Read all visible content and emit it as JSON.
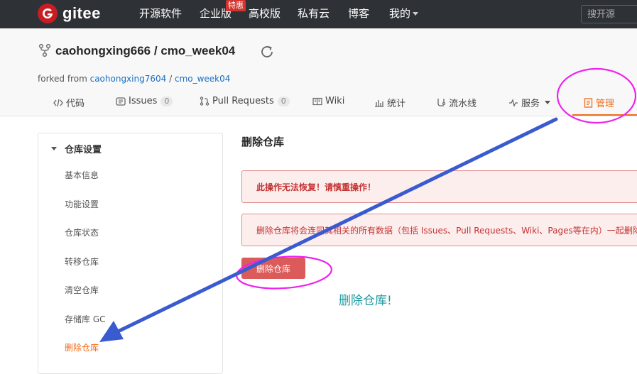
{
  "nav": {
    "brand": "gitee",
    "items": [
      "开源软件",
      "企业版",
      "高校版",
      "私有云",
      "博客",
      "我的"
    ],
    "hot_badge": "特惠",
    "search_placeholder": "搜开源"
  },
  "repo": {
    "owner": "caohongxing666",
    "separator": "/",
    "name": "cmo_week04",
    "forked_prefix": "forked from",
    "forked_owner": "caohongxing7604",
    "forked_name": "cmo_week04"
  },
  "tabs": [
    {
      "label": "代码",
      "icon": "code-icon"
    },
    {
      "label": "Issues",
      "count": "0",
      "icon": "issues-icon"
    },
    {
      "label": "Pull Requests",
      "count": "0",
      "icon": "pull-request-icon"
    },
    {
      "label": "Wiki",
      "icon": "wiki-icon"
    },
    {
      "label": "统计",
      "icon": "stats-icon"
    },
    {
      "label": "流水线",
      "icon": "pipeline-icon"
    },
    {
      "label": "服务",
      "icon": "service-icon"
    },
    {
      "label": "管理",
      "icon": "manage-icon",
      "active": true
    }
  ],
  "sidebar": {
    "header": "仓库设置",
    "items": [
      "基本信息",
      "功能设置",
      "仓库状态",
      "转移仓库",
      "清空仓库",
      "存储库 GC",
      "删除仓库"
    ],
    "active_index": 6
  },
  "main": {
    "title": "删除仓库",
    "warning": "此操作无法恢复！请慎重操作！",
    "description": "删除仓库将会连同其相关的所有数据（包括 Issues、Pull Requests、Wiki、Pages等在内）一起删除",
    "button": "删除仓库"
  },
  "annotation": {
    "note": "删除仓库!",
    "circle_color": "#ee22ee",
    "arrow_color": "#3a5bd0"
  },
  "colors": {
    "accent": "#f06c1a",
    "danger": "#db5a5a",
    "topbar": "#2e3237",
    "logo": "#c71d23"
  }
}
